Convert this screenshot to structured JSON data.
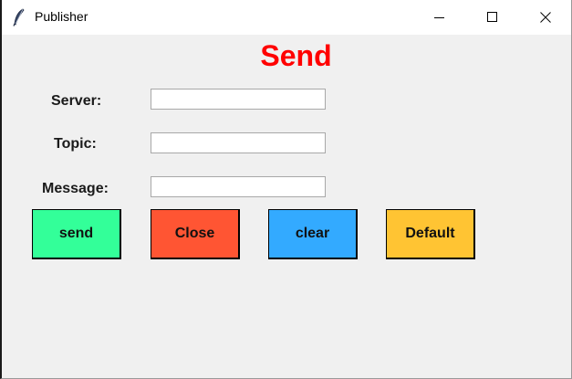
{
  "window": {
    "title": "Publisher",
    "app_icon": "feather-icon",
    "controls": {
      "minimize_icon": "minimize-icon",
      "maximize_icon": "maximize-icon",
      "close_icon": "close-icon"
    }
  },
  "form": {
    "heading": "Send",
    "heading_color": "#ff0000",
    "fields": [
      {
        "label": "Server:",
        "value": "",
        "placeholder": ""
      },
      {
        "label": "Topic:",
        "value": "",
        "placeholder": ""
      },
      {
        "label": "Message:",
        "value": "",
        "placeholder": ""
      }
    ],
    "buttons": [
      {
        "label": "send",
        "color": "#33ff99"
      },
      {
        "label": "Close",
        "color": "#ff5533"
      },
      {
        "label": "clear",
        "color": "#33aaff"
      },
      {
        "label": "Default",
        "color": "#ffc433"
      }
    ]
  }
}
